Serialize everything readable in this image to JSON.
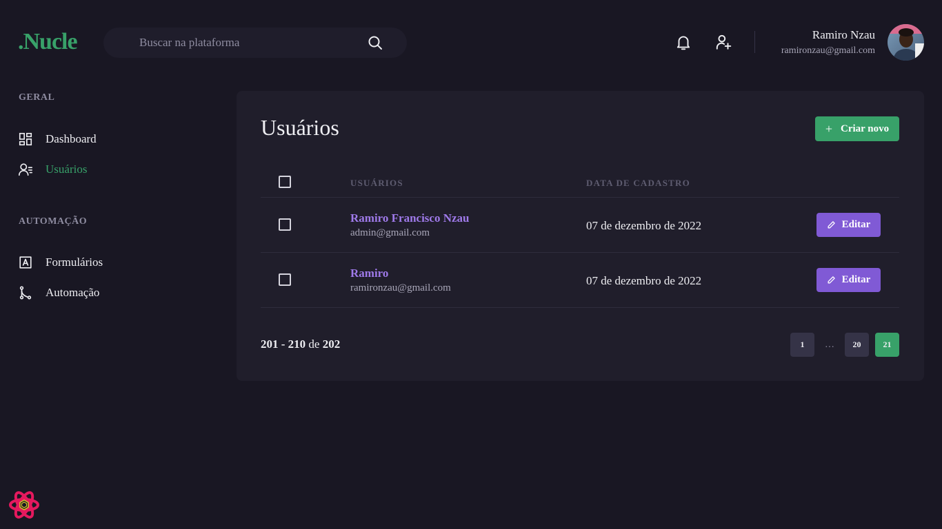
{
  "header": {
    "logo": ".Nucle",
    "search_placeholder": "Buscar na plataforma",
    "user": {
      "name": "Ramiro Nzau",
      "email": "ramironzau@gmail.com"
    }
  },
  "sidebar": {
    "sections": [
      {
        "title": "GERAL",
        "items": [
          {
            "label": "Dashboard",
            "icon": "dashboard-icon"
          },
          {
            "label": "Usuários",
            "icon": "users-icon",
            "active": true
          }
        ]
      },
      {
        "title": "AUTOMAÇÃO",
        "items": [
          {
            "label": "Formulários",
            "icon": "form-icon"
          },
          {
            "label": "Automação",
            "icon": "git-branch-icon"
          }
        ]
      }
    ]
  },
  "main": {
    "title": "Usuários",
    "create_button": "Criar novo",
    "table": {
      "columns": [
        "USUÁRIOS",
        "DATA DE CADASTRO"
      ],
      "rows": [
        {
          "name": "Ramiro Francisco Nzau",
          "email": "admin@gmail.com",
          "date": "07 de dezembro de 2022",
          "action": "Editar"
        },
        {
          "name": "Ramiro",
          "email": "ramironzau@gmail.com",
          "date": "07 de dezembro de 2022",
          "action": "Editar"
        }
      ]
    },
    "pagination": {
      "range_start": "201",
      "range_sep": " - ",
      "range_end": "210",
      "of": " de ",
      "total": "202",
      "pages": [
        "1",
        "…",
        "20",
        "21"
      ],
      "current": "21"
    }
  },
  "colors": {
    "background": "#191723",
    "card": "#201e2b",
    "accent_green": "#38a169",
    "accent_purple": "#805ad5",
    "link_purple": "#9f7aea"
  }
}
